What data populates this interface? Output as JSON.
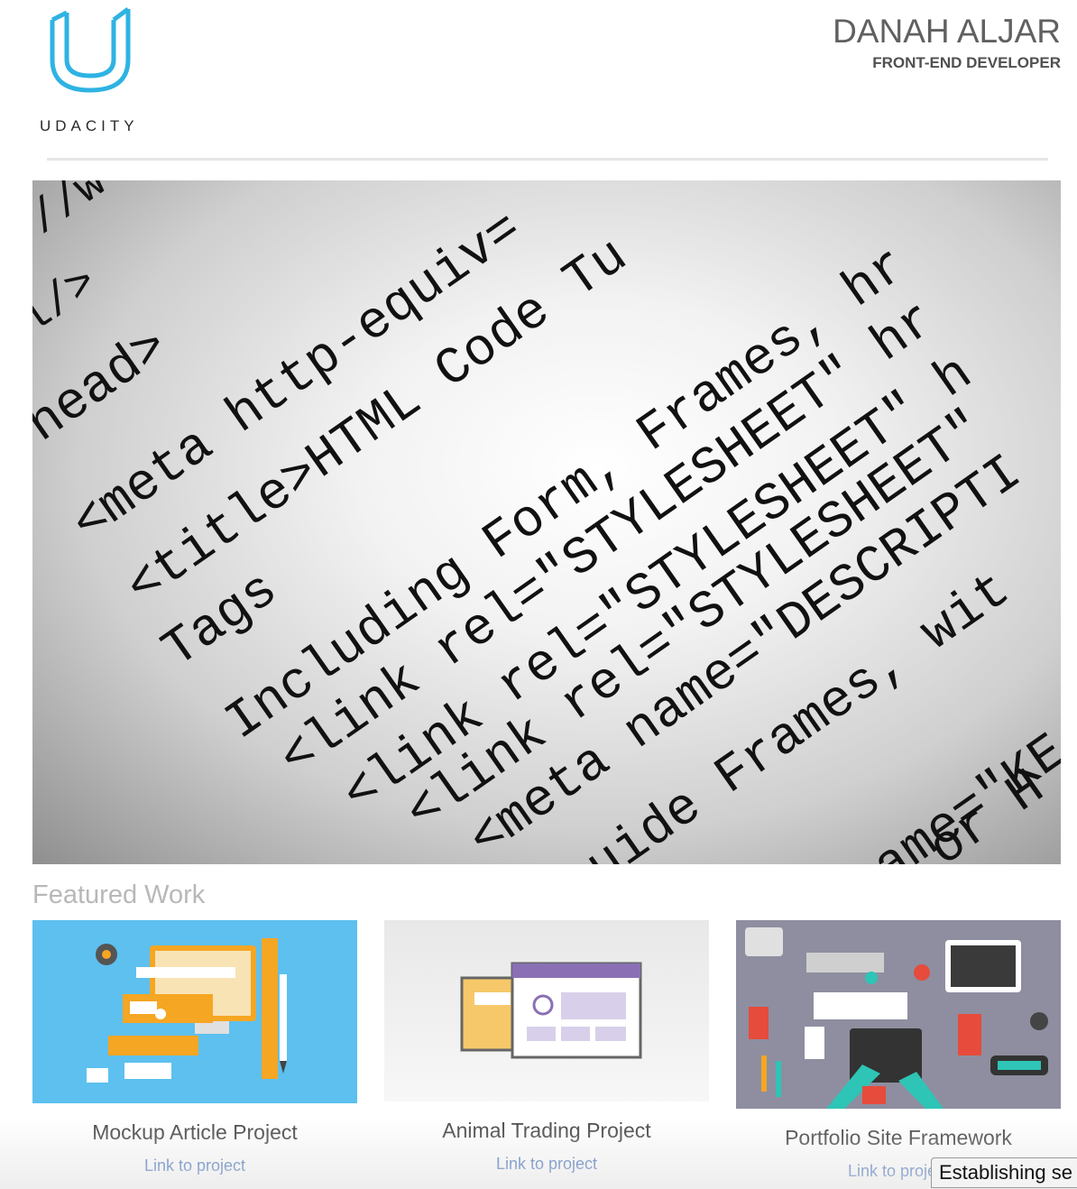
{
  "header": {
    "logo_text": "UDACITY",
    "name": "DANAH ALJAR",
    "role": "FRONT-END DEVELOPER",
    "brand_color": "#2eb3e3"
  },
  "hero": {
    "image_description_icon": "html-code-photo",
    "code_lines": [
      "//w",
      "l/>",
      "head>",
      "<meta http-equiv=",
      "<title>HTML Code Tu",
      "Tags",
      "Including Form, Frames, hr",
      "<link rel=\"STYLESHEET\" hr",
      "<link rel=\"STYLESHEET\" h",
      "<link rel=\"STYLESHEET\"",
      "<meta name=\"DESCRIPTI",
      "uide  Frames, wit",
      "name=\"KE",
      "or H"
    ]
  },
  "featured": {
    "title": "Featured Work",
    "projects": [
      {
        "title": "Mockup Article Project",
        "link": "Link to project",
        "bg": "#5dc0ef"
      },
      {
        "title": "Animal Trading Project",
        "link": "Link to project",
        "bg": "#eeeeee"
      },
      {
        "title": "Portfolio Site Framework",
        "link": "Link to project",
        "bg": "#8e8ea0"
      }
    ]
  },
  "status_bar": {
    "text": "Establishing se"
  }
}
